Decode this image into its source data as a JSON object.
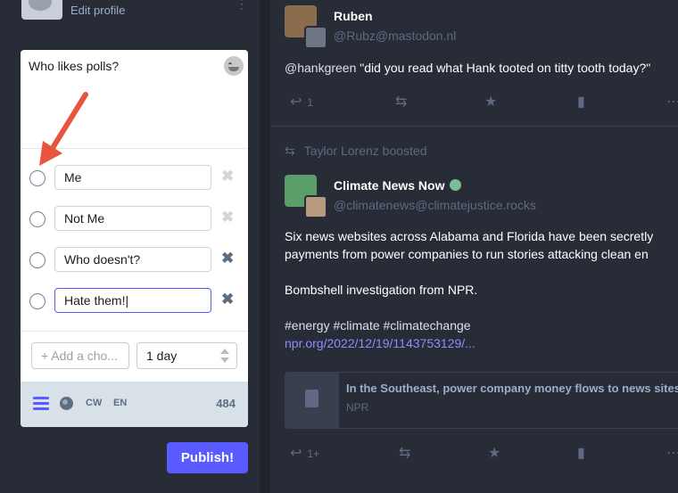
{
  "profile": {
    "edit_label": "Edit profile",
    "menu_glyph": "⋮"
  },
  "composer": {
    "text": "Who likes polls?",
    "emoji_icon": "grinning-face-icon",
    "poll": {
      "options": [
        {
          "value": "Me",
          "removable": false
        },
        {
          "value": "Not Me",
          "removable": false
        },
        {
          "value": "Who doesn't?",
          "removable": true
        },
        {
          "value": "Hate them!|",
          "removable": true
        }
      ],
      "remove_glyph": "✖",
      "add_choice_label": "+ Add a cho...",
      "duration": "1 day"
    },
    "footer": {
      "cw_label": "CW",
      "lang_label": "EN",
      "char_count": "484"
    },
    "publish_label": "Publish!"
  },
  "feed": {
    "statuses": [
      {
        "display_name": "Ruben",
        "acct": "@Rubz@mastodon.nl",
        "mention": "@hankgreen",
        "text": " \"did you read what Hank tooted on titty tooth today?\"",
        "reply_count": "1"
      },
      {
        "boosted_by": "Taylor Lorenz boosted",
        "display_name": "Climate News Now",
        "acct": "@climatenews@climatejustice.rocks",
        "paragraph1_line1": "Six news websites across Alabama and Florida have been secretly",
        "paragraph1_line2": "payments from power companies to run stories attacking clean en",
        "paragraph2": "Bombshell investigation from NPR.",
        "hashtags": "#energy #climate #climatechange",
        "link": "npr.org/2022/12/19/1143753129/...",
        "card_title": "In the Southeast, power company money flows to news sites",
        "card_provider": "NPR",
        "reply_count": "1+"
      }
    ]
  },
  "colors": {
    "accent": "#595aff",
    "background": "#282c37",
    "annotation_arrow": "#e8553e"
  }
}
